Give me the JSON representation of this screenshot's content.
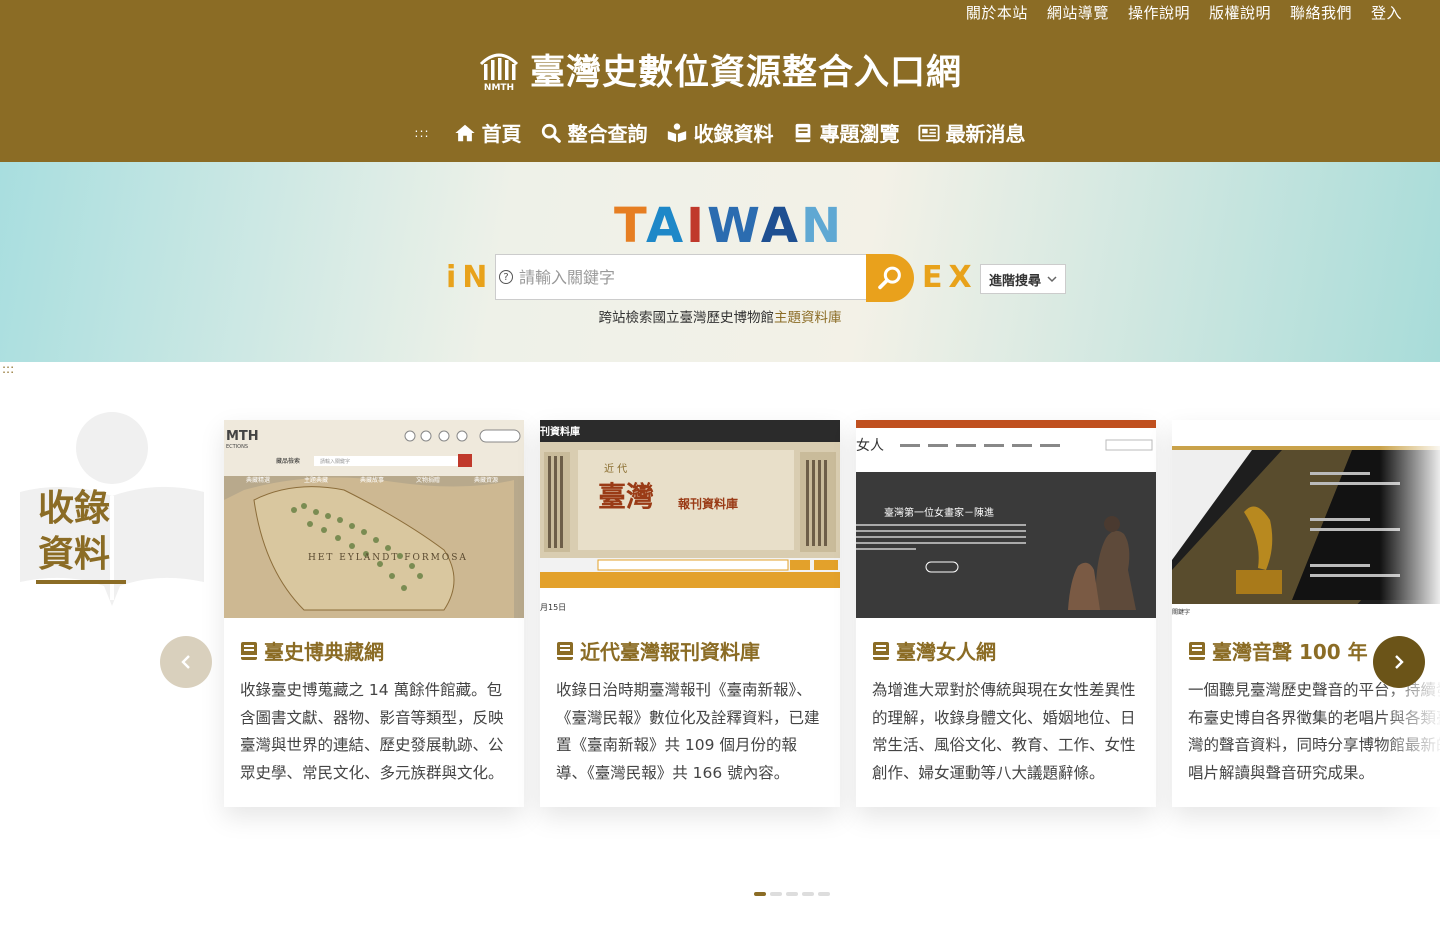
{
  "header": {
    "top_links": [
      "關於本站",
      "網站導覽",
      "操作說明",
      "版權說明",
      "聯絡我們",
      "登入"
    ],
    "logo_text": "NMTH",
    "site_title": "臺灣史數位資源整合入口網",
    "nav": [
      {
        "label": "首頁",
        "icon": "home-icon"
      },
      {
        "label": "整合查詢",
        "icon": "search-icon"
      },
      {
        "label": "收錄資料",
        "icon": "reader-icon"
      },
      {
        "label": "專題瀏覽",
        "icon": "book-icon"
      },
      {
        "label": "最新消息",
        "icon": "newspaper-icon"
      }
    ],
    "nav_dots": ":::"
  },
  "hero": {
    "taiwan": {
      "t": "T",
      "a1": "A",
      "i": "I",
      "w": "W",
      "a2": "A",
      "n": "N"
    },
    "in_text": "iN",
    "ex_text": "EX",
    "search_placeholder": "請輸入關鍵字",
    "help_glyph": "?",
    "advanced_search": "進階搜尋",
    "caption_prefix": "跨站檢索國立臺灣歷史博物館",
    "caption_highlight": "主題資料庫"
  },
  "section": {
    "dots": ":::",
    "label_line1": "收錄",
    "label_line2": "資料"
  },
  "cards": [
    {
      "title": "臺史博典藏網",
      "desc": "收錄臺史博蒐藏之 14 萬餘件館藏。包含圖書文獻、器物、影音等類型，反映臺灣與世界的連結、歷史發展軌跡、公眾史學、常民文化、多元族群與文化。",
      "shot": {
        "brand": "MTH",
        "brand_sub": "ECTIONS",
        "search_placeholder": "請輸入關鍵字",
        "tabs": [
          "典藏精選",
          "主題典藏",
          "典藏故事",
          "文物捐贈",
          "典藏資源"
        ],
        "search_label": "藏品檢索",
        "map_label": "HET EYLANDT FORMOSA"
      }
    },
    {
      "title": "近代臺灣報刊資料庫",
      "desc": "收錄日治時期臺灣報刊《臺南新報》、《臺灣民報》數位化及詮釋資料，已建置《臺南新報》共 109 個月份的報導、《臺灣民報》共 166 號內容。",
      "shot": {
        "top_title": "刊資料庫",
        "banner_small": "近 代",
        "banner_big": "臺灣",
        "banner_side": "報刊資料庫",
        "bottom_date": "月15日"
      }
    },
    {
      "title": "臺灣女人網",
      "desc": "為增進大眾對於傳統與現在女性差異性的理解，收錄身體文化、婚姻地位、日常生活、風俗文化、教育、工作、女性創作、婦女運動等八大議題辭條。",
      "shot": {
        "logo": "女人",
        "feature_title": "臺灣第一位女畫家－陳進"
      }
    },
    {
      "title": "臺灣音聲 100 年",
      "desc": "一個聽見臺灣歷史聲音的平台，持續發布臺史博自各界徵集的老唱片與各類臺灣的聲音資料，同時分享博物館最新的唱片解讀與聲音研究成果。",
      "shot": {
        "label": "關鍵字"
      }
    }
  ],
  "pager": {
    "count": 5,
    "active": 0
  }
}
